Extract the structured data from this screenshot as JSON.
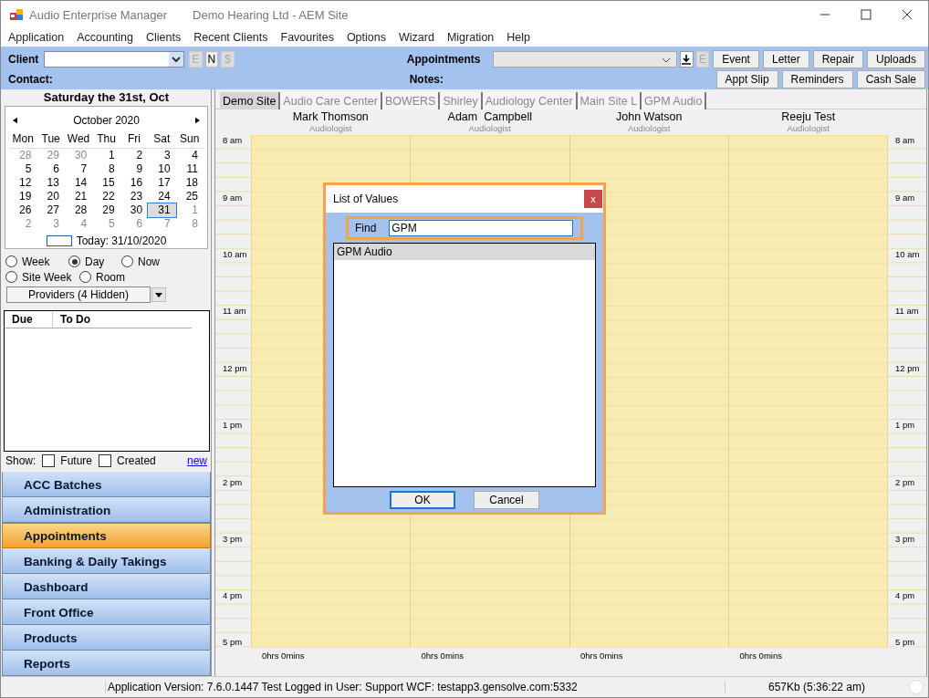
{
  "window": {
    "title": "Audio Enterprise Manager",
    "subtitle": "Demo Hearing Ltd - AEM Site"
  },
  "menu": [
    "Application",
    "Accounting",
    "Clients",
    "Recent Clients",
    "Favourites",
    "Options",
    "Wizard",
    "Migration",
    "Help"
  ],
  "toolbar": {
    "client_label": "Client",
    "client_buttons": [
      {
        "label": "E",
        "disabled": true
      },
      {
        "label": "N",
        "disabled": false
      },
      {
        "label": "$",
        "disabled": true
      }
    ],
    "appointments_label": "Appointments",
    "appointment_buttons": [
      {
        "label": "E",
        "disabled": true
      }
    ],
    "row1_buttons": [
      "Event",
      "Letter",
      "Repair",
      "Uploads"
    ],
    "contact_label": "Contact:",
    "notes_label": "Notes:",
    "row2_buttons": [
      "Appt Slip",
      "Reminders",
      "Cash Sale"
    ]
  },
  "calendar": {
    "heading": "Saturday the 31st, Oct",
    "month": "October 2020",
    "weekdays": [
      "Mon",
      "Tue",
      "Wed",
      "Thu",
      "Fri",
      "Sat",
      "Sun"
    ],
    "weeks": [
      [
        {
          "day": "28",
          "other_month": true,
          "selected": false
        },
        {
          "day": "29",
          "other_month": true,
          "selected": false
        },
        {
          "day": "30",
          "other_month": true,
          "selected": false
        },
        {
          "day": "1",
          "other_month": false,
          "selected": false
        },
        {
          "day": "2",
          "other_month": false,
          "selected": false
        },
        {
          "day": "3",
          "other_month": false,
          "selected": false
        },
        {
          "day": "4",
          "other_month": false,
          "selected": false
        }
      ],
      [
        {
          "day": "5",
          "other_month": false,
          "selected": false
        },
        {
          "day": "6",
          "other_month": false,
          "selected": false
        },
        {
          "day": "7",
          "other_month": false,
          "selected": false
        },
        {
          "day": "8",
          "other_month": false,
          "selected": false
        },
        {
          "day": "9",
          "other_month": false,
          "selected": false
        },
        {
          "day": "10",
          "other_month": false,
          "selected": false
        },
        {
          "day": "11",
          "other_month": false,
          "selected": false
        }
      ],
      [
        {
          "day": "12",
          "other_month": false,
          "selected": false
        },
        {
          "day": "13",
          "other_month": false,
          "selected": false
        },
        {
          "day": "14",
          "other_month": false,
          "selected": false
        },
        {
          "day": "15",
          "other_month": false,
          "selected": false
        },
        {
          "day": "16",
          "other_month": false,
          "selected": false
        },
        {
          "day": "17",
          "other_month": false,
          "selected": false
        },
        {
          "day": "18",
          "other_month": false,
          "selected": false
        }
      ],
      [
        {
          "day": "19",
          "other_month": false,
          "selected": false
        },
        {
          "day": "20",
          "other_month": false,
          "selected": false
        },
        {
          "day": "21",
          "other_month": false,
          "selected": false
        },
        {
          "day": "22",
          "other_month": false,
          "selected": false
        },
        {
          "day": "23",
          "other_month": false,
          "selected": false
        },
        {
          "day": "24",
          "other_month": false,
          "selected": false
        },
        {
          "day": "25",
          "other_month": false,
          "selected": false
        }
      ],
      [
        {
          "day": "26",
          "other_month": false,
          "selected": false
        },
        {
          "day": "27",
          "other_month": false,
          "selected": false
        },
        {
          "day": "28",
          "other_month": false,
          "selected": false
        },
        {
          "day": "29",
          "other_month": false,
          "selected": false
        },
        {
          "day": "30",
          "other_month": false,
          "selected": false
        },
        {
          "day": "31",
          "other_month": false,
          "selected": true
        },
        {
          "day": "1",
          "other_month": true,
          "selected": false
        }
      ],
      [
        {
          "day": "2",
          "other_month": true,
          "selected": false
        },
        {
          "day": "3",
          "other_month": true,
          "selected": false
        },
        {
          "day": "4",
          "other_month": true,
          "selected": false
        },
        {
          "day": "5",
          "other_month": true,
          "selected": false
        },
        {
          "day": "6",
          "other_month": true,
          "selected": false
        },
        {
          "day": "7",
          "other_month": true,
          "selected": false
        },
        {
          "day": "8",
          "other_month": true,
          "selected": false
        }
      ]
    ],
    "today": "Today: 31/10/2020"
  },
  "view_options": [
    {
      "label": "Week",
      "selected": false
    },
    {
      "label": "Day",
      "selected": true
    },
    {
      "label": "Now",
      "selected": false
    },
    {
      "label": "Site Week",
      "selected": false
    },
    {
      "label": "Room",
      "selected": false
    }
  ],
  "providers_filter": "Providers (4 Hidden)",
  "todo": {
    "columns": [
      "Due",
      "To Do"
    ]
  },
  "show": {
    "label": "Show:",
    "options": [
      {
        "label": "Future",
        "checked": false
      },
      {
        "label": "Created",
        "checked": false
      }
    ],
    "link": "new"
  },
  "nav": [
    {
      "label": "ACC Batches",
      "selected": false
    },
    {
      "label": "Administration",
      "selected": false
    },
    {
      "label": "Appointments",
      "selected": true
    },
    {
      "label": "Banking & Daily Takings",
      "selected": false
    },
    {
      "label": "Dashboard",
      "selected": false
    },
    {
      "label": "Front Office",
      "selected": false
    },
    {
      "label": "Products",
      "selected": false
    },
    {
      "label": "Reports",
      "selected": false
    }
  ],
  "schedule": {
    "tabs": [
      {
        "label": "Demo Site",
        "selected": true
      },
      {
        "label": "Audio Care Center",
        "selected": false
      },
      {
        "label": "BOWERS",
        "selected": false
      },
      {
        "label": "Shirley",
        "selected": false
      },
      {
        "label": "Audiology Center",
        "selected": false
      },
      {
        "label": "Main Site L",
        "selected": false
      },
      {
        "label": "GPM Audio",
        "selected": false
      }
    ],
    "providers": [
      {
        "name": "Mark Thomson",
        "role": "Audiologist",
        "total": "0hrs 0mins"
      },
      {
        "name": "Adam  Campbell",
        "role": "Audiologist",
        "total": "0hrs 0mins"
      },
      {
        "name": "John Watson",
        "role": "Audiologist",
        "total": "0hrs 0mins"
      },
      {
        "name": "Reeju Test",
        "role": "Audiologist",
        "total": "0hrs 0mins"
      }
    ],
    "hours_left": [
      "8 am",
      "9 am",
      "10 am",
      "11 am",
      "12 pm",
      "1 pm",
      "2 pm",
      "3 pm",
      "4 pm",
      "5 pm"
    ],
    "hours_right": [
      "8 am",
      "9 am",
      "10 am",
      "11 am",
      "12 pm",
      "1 pm",
      "2 pm",
      "3 pm",
      "4 pm",
      "5 pm"
    ]
  },
  "dialog": {
    "title": "List of Values",
    "close": "x",
    "find_label": "Find",
    "find_value": "GPM",
    "items": [
      {
        "label": "GPM Audio",
        "selected": true
      }
    ],
    "buttons": [
      {
        "label": "OK",
        "default": true
      },
      {
        "label": "Cancel",
        "default": false
      }
    ]
  },
  "status_bar": {
    "text": "Application Version: 7.6.0.1447 Test  Logged in User: Support WCF: testapp3.gensolve.com:5332",
    "memory": "657Kb  (5:36:22 am)"
  }
}
